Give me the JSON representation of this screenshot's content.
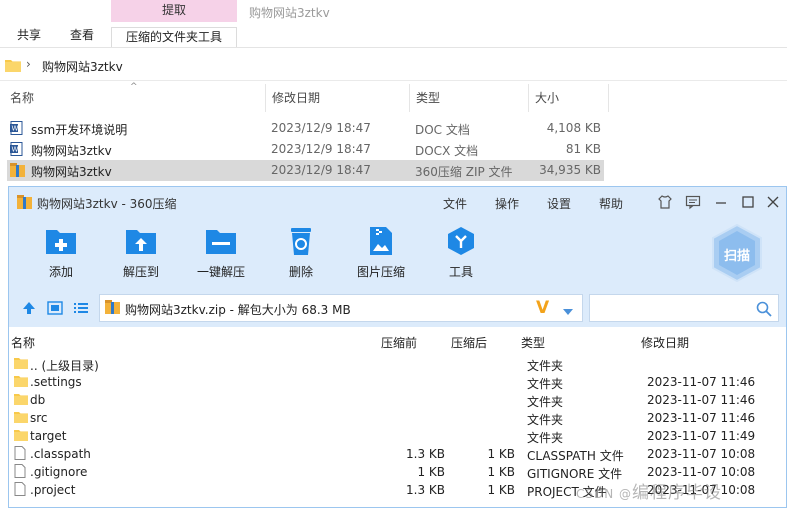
{
  "explorer": {
    "ribbon": {
      "context_tab": "提取",
      "window_title": "购物网站3ztkv",
      "tabs": [
        "共享",
        "查看",
        "压缩的文件夹工具"
      ]
    },
    "address_path": "购物网站3ztkv",
    "columns": {
      "name": "名称",
      "date": "修改日期",
      "type": "类型",
      "size": "大小"
    },
    "files": [
      {
        "name": "ssm开发环境说明",
        "date": "2023/12/9 18:47",
        "type": "DOC 文档",
        "size": "4,108 KB",
        "icon": "word-doc-icon"
      },
      {
        "name": "购物网站3ztkv",
        "date": "2023/12/9 18:47",
        "type": "DOCX 文档",
        "size": "81 KB",
        "icon": "word-doc-icon"
      },
      {
        "name": "购物网站3ztkv",
        "date": "2023/12/9 18:47",
        "type": "360压缩 ZIP 文件",
        "size": "34,935 KB",
        "icon": "zip-archive-icon",
        "selected": true
      }
    ]
  },
  "zip_window": {
    "title": "购物网站3ztkv - 360压缩",
    "menu": [
      "文件",
      "操作",
      "设置",
      "帮助"
    ],
    "toolbar": [
      "添加",
      "解压到",
      "一键解压",
      "删除",
      "图片压缩",
      "工具"
    ],
    "scan_label": "扫描",
    "path_text": "购物网站3ztkv.zip - 解包大小为 68.3 MB",
    "path_logo": "V",
    "columns": {
      "name": "名称",
      "packed": "压缩前",
      "unpacked": "压缩后",
      "type": "类型",
      "date": "修改日期"
    },
    "rows": [
      {
        "name": ".. (上级目录)",
        "packed": "",
        "unpacked": "",
        "type": "文件夹",
        "date": "",
        "icon": "folder-icon"
      },
      {
        "name": ".settings",
        "packed": "",
        "unpacked": "",
        "type": "文件夹",
        "date": "2023-11-07 11:46",
        "icon": "folder-icon"
      },
      {
        "name": "db",
        "packed": "",
        "unpacked": "",
        "type": "文件夹",
        "date": "2023-11-07 11:46",
        "icon": "folder-icon"
      },
      {
        "name": "src",
        "packed": "",
        "unpacked": "",
        "type": "文件夹",
        "date": "2023-11-07 11:46",
        "icon": "folder-icon"
      },
      {
        "name": "target",
        "packed": "",
        "unpacked": "",
        "type": "文件夹",
        "date": "2023-11-07 11:49",
        "icon": "folder-icon"
      },
      {
        "name": ".classpath",
        "packed": "1.3 KB",
        "unpacked": "1 KB",
        "type": "CLASSPATH 文件",
        "date": "2023-11-07 10:08",
        "icon": "file-icon"
      },
      {
        "name": ".gitignore",
        "packed": "1 KB",
        "unpacked": "1 KB",
        "type": "GITIGNORE 文件",
        "date": "2023-11-07 10:08",
        "icon": "file-icon"
      },
      {
        "name": ".project",
        "packed": "1.3 KB",
        "unpacked": "1 KB",
        "type": "PROJECT 文件",
        "date": "2023-11-07 10:08",
        "icon": "file-icon"
      }
    ]
  },
  "watermark": {
    "prefix": "CSDN @",
    "text": "编程序毕设"
  },
  "colors": {
    "accent_blue": "#1e88e5",
    "folder_yellow": "#f8c94a",
    "window_bg": "#dcebfb",
    "context_tab_pink": "#f6d2e8"
  }
}
